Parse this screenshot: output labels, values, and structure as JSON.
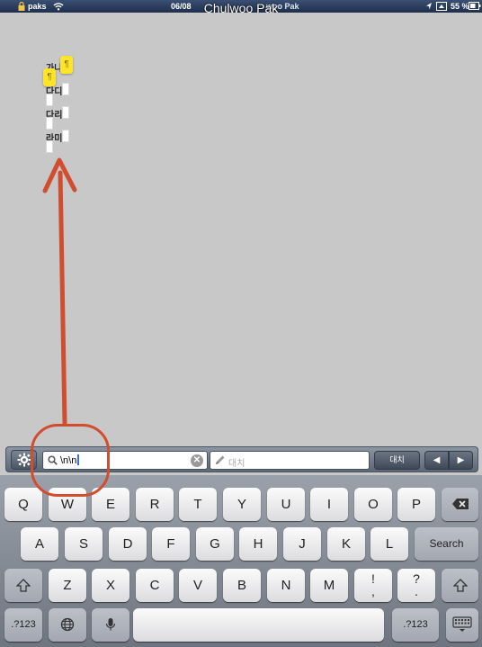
{
  "status_bar": {
    "carrier": "paks",
    "date": "06/08",
    "title_underlay": "woo Pak",
    "title_overlay": "Chulwoo Pak",
    "battery_pct": "55 %"
  },
  "document": {
    "lines": [
      "가나",
      "다디",
      "다리",
      "라미"
    ],
    "pilcrow_symbol": "¶"
  },
  "annotation": {
    "arrow_color": "#d14d2f"
  },
  "find_bar": {
    "search_value": "\\n\\n",
    "clear_symbol": "✕",
    "replace_placeholder": "대치",
    "replace_button_label": "대치",
    "prev_symbol": "◀",
    "next_symbol": "▶",
    "settings_icon": "gear-icon"
  },
  "keyboard": {
    "row1": [
      "Q",
      "W",
      "E",
      "R",
      "T",
      "Y",
      "U",
      "I",
      "O",
      "P"
    ],
    "row2": [
      "A",
      "S",
      "D",
      "F",
      "G",
      "H",
      "J",
      "K",
      "L"
    ],
    "search_label": "Search",
    "row3": [
      "Z",
      "X",
      "C",
      "V",
      "B",
      "N",
      "M"
    ],
    "punct1_top": "!",
    "punct1_bottom": ",",
    "punct2_top": "?",
    "punct2_bottom": ".",
    "numbers_label": ".?123"
  }
}
